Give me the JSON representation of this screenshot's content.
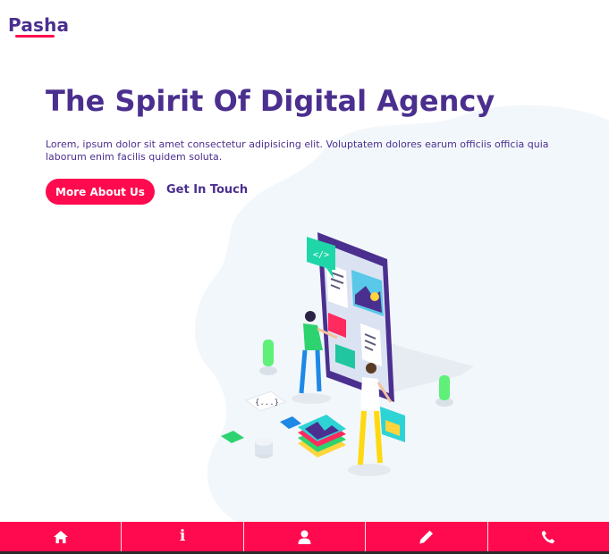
{
  "brand": {
    "name": "Pasha"
  },
  "hero": {
    "title": "The Spirit Of Digital Agency",
    "description": "Lorem, ipsum dolor sit amet consectetur adipisicing elit. Voluptatem dolores earum officiis officia quia laborum enim facilis quidem soluta.",
    "primary_button": "More About Us",
    "secondary_link": "Get In Touch"
  },
  "illustration": {
    "code_tag": "</>",
    "braces_tag": "{...}"
  },
  "bottom_nav": {
    "items": [
      {
        "icon": "home-icon"
      },
      {
        "icon": "info-icon",
        "glyph": "i"
      },
      {
        "icon": "user-icon"
      },
      {
        "icon": "pencil-icon"
      },
      {
        "icon": "phone-icon"
      }
    ]
  },
  "colors": {
    "brand": "#4b2f8f",
    "accent": "#ff0a4e",
    "blob": "#f2f7fb"
  }
}
